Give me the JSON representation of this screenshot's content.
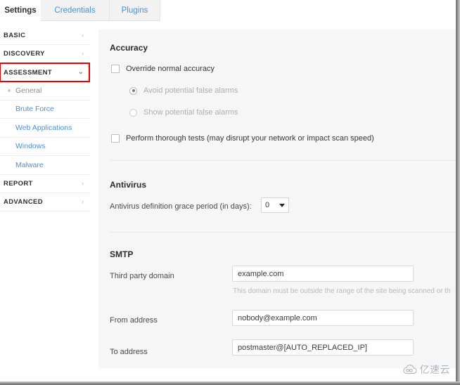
{
  "tabs": [
    {
      "label": "Settings",
      "active": true
    },
    {
      "label": "Credentials",
      "active": false
    },
    {
      "label": "Plugins",
      "active": false
    }
  ],
  "sidebar": {
    "groups": [
      {
        "label": "BASIC",
        "chevron": "chevron-right",
        "expanded": false,
        "highlighted": false
      },
      {
        "label": "DISCOVERY",
        "chevron": "chevron-right",
        "expanded": false,
        "highlighted": false
      },
      {
        "label": "ASSESSMENT",
        "chevron": "chevron-down",
        "expanded": true,
        "highlighted": true
      },
      {
        "label": "REPORT",
        "chevron": "chevron-right",
        "expanded": false,
        "highlighted": false
      },
      {
        "label": "ADVANCED",
        "chevron": "chevron-right",
        "expanded": false,
        "highlighted": false
      }
    ],
    "subitems": [
      {
        "label": "General",
        "current": true
      },
      {
        "label": "Brute Force",
        "current": false
      },
      {
        "label": "Web Applications",
        "current": false
      },
      {
        "label": "Windows",
        "current": false
      },
      {
        "label": "Malware",
        "current": false
      }
    ],
    "highlight_color": "#e60000"
  },
  "main": {
    "accuracy": {
      "title": "Accuracy",
      "override_checkbox": {
        "label": "Override normal accuracy",
        "checked": false
      },
      "radios": [
        {
          "label": "Avoid potential false alarms",
          "selected": true,
          "disabled": true
        },
        {
          "label": "Show potential false alarms",
          "selected": false,
          "disabled": true
        }
      ],
      "thorough_checkbox": {
        "label": "Perform thorough tests (may disrupt your network or impact scan speed)",
        "checked": false
      }
    },
    "antivirus": {
      "title": "Antivirus",
      "grace_label": "Antivirus definition grace period (in days):",
      "grace_value": "0"
    },
    "smtp": {
      "title": "SMTP",
      "fields": [
        {
          "label": "Third party domain",
          "value": "example.com",
          "help": "This domain must be outside the range of the site being scanned or th"
        },
        {
          "label": "From address",
          "value": "nobody@example.com",
          "help": ""
        },
        {
          "label": "To address",
          "value": "postmaster@[AUTO_REPLACED_IP]",
          "help": ""
        }
      ]
    }
  },
  "watermark": {
    "text": "亿速云",
    "icon": "cloud-icon"
  }
}
